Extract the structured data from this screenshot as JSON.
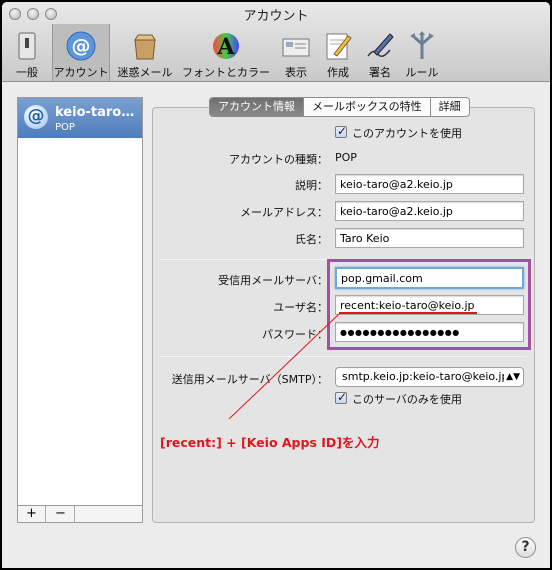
{
  "window": {
    "title": "アカウント"
  },
  "toolbar": {
    "items": [
      {
        "label": "一般",
        "icon": "general-switch-icon"
      },
      {
        "label": "アカウント",
        "icon": "at-sign-icon",
        "selected": true
      },
      {
        "label": "迷惑メール",
        "icon": "junk-mail-bin-icon"
      },
      {
        "label": "フォントとカラー",
        "icon": "font-color-icon"
      },
      {
        "label": "表示",
        "icon": "display-icon"
      },
      {
        "label": "作成",
        "icon": "compose-pencil-icon"
      },
      {
        "label": "署名",
        "icon": "signature-pen-icon"
      },
      {
        "label": "ルール",
        "icon": "rules-arrows-icon"
      }
    ]
  },
  "sidebar": {
    "account": {
      "name": "keio-taro…",
      "type": "POP"
    },
    "add_label": "+",
    "remove_label": "−"
  },
  "tabs": [
    {
      "label": "アカウント情報",
      "active": true
    },
    {
      "label": "メールボックスの特性",
      "active": false
    },
    {
      "label": "詳細",
      "active": false
    }
  ],
  "account_info": {
    "enable_label": "このアカウントを使用",
    "enable_checked": true,
    "type_label": "アカウントの種類：",
    "type_value": "POP",
    "description_label": "説明：",
    "description_value": "keio-taro@a2.keio.jp",
    "email_label": "メールアドレス：",
    "email_value": "keio-taro@a2.keio.jp",
    "name_label": "氏名：",
    "name_value": "Taro Keio",
    "incoming_server_label": "受信用メールサーバ：",
    "incoming_server_value": "pop.gmail.com",
    "username_label": "ユーザ名：",
    "username_value": "recent:keio-taro@keio.jp",
    "password_label": "パスワード：",
    "password_value": "●●●●●●●●●●●●●●●●",
    "smtp_label": "送信用メールサーバ（SMTP）：",
    "smtp_value": "smtp.keio.jp:keio-taro@keio.jp",
    "smtp_only_label": "このサーバのみを使用",
    "smtp_only_checked": true
  },
  "annotation": {
    "text": "[recent:] + [Keio Apps ID]を入力",
    "color": "#e0151d",
    "box_color": "#a2519f"
  },
  "help_label": "?"
}
